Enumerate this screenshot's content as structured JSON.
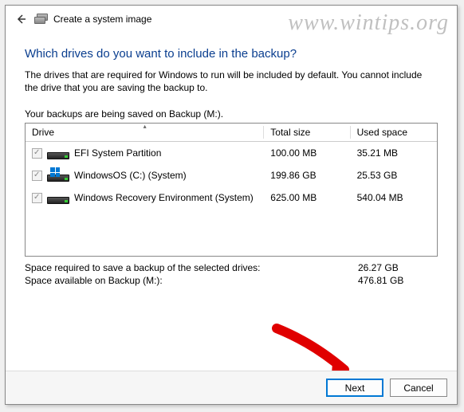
{
  "window": {
    "title": "Create a system image"
  },
  "watermark": "www.wintips.org",
  "heading": "Which drives do you want to include in the backup?",
  "description": "The drives that are required for Windows to run will be included by default. You cannot include the drive that you are saving the backup to.",
  "saving_line": "Your backups are being saved on Backup (M:).",
  "columns": {
    "drive": "Drive",
    "total": "Total size",
    "used": "Used space"
  },
  "drives": [
    {
      "name": "EFI System Partition",
      "total": "100.00 MB",
      "used": "35.21 MB",
      "has_winlogo": false
    },
    {
      "name": "WindowsOS (C:) (System)",
      "total": "199.86 GB",
      "used": "25.53 GB",
      "has_winlogo": true
    },
    {
      "name": "Windows Recovery Environment (System)",
      "total": "625.00 MB",
      "used": "540.04 MB",
      "has_winlogo": false
    }
  ],
  "summary": {
    "required_label": "Space required to save a backup of the selected drives:",
    "required_value": "26.27 GB",
    "available_label": "Space available on Backup (M:):",
    "available_value": "476.81 GB"
  },
  "buttons": {
    "next": "Next",
    "cancel": "Cancel"
  }
}
